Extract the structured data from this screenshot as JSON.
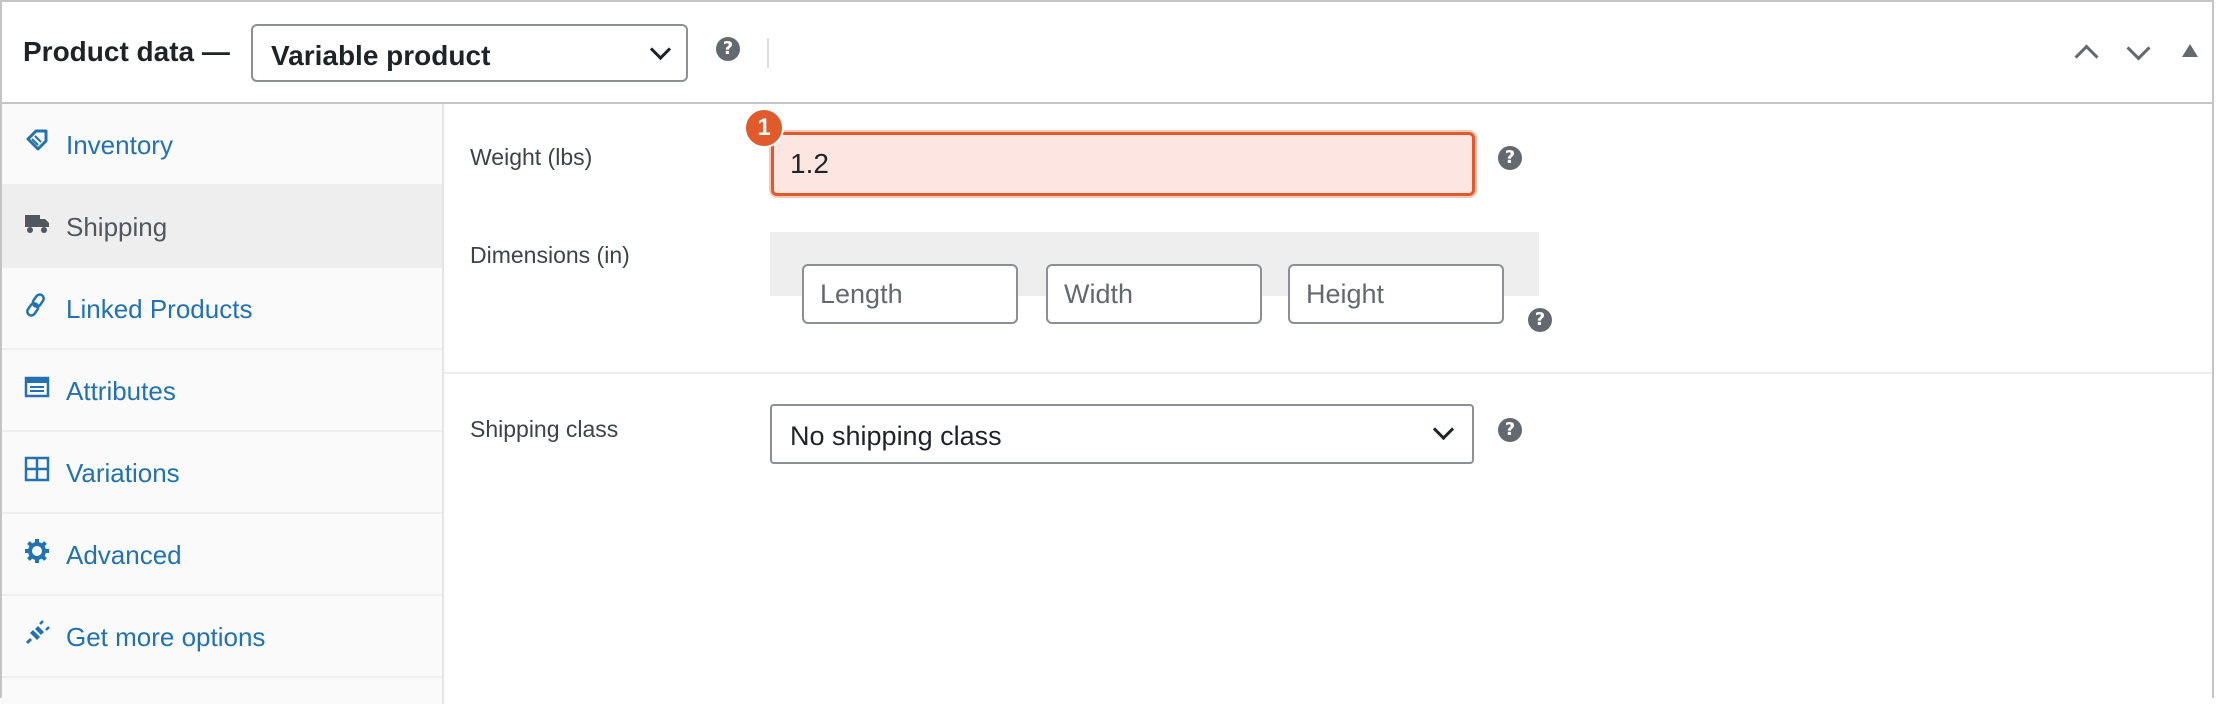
{
  "header": {
    "title": "Product data —",
    "product_type": "Variable product",
    "help_icon": "question-circle-icon",
    "controls": [
      "move-up-icon",
      "move-down-icon",
      "collapse-toggle-icon"
    ]
  },
  "sidebar": {
    "items": [
      {
        "label": "Inventory",
        "icon": "tag-icon",
        "active": false
      },
      {
        "label": "Shipping",
        "icon": "truck-icon",
        "active": true
      },
      {
        "label": "Linked Products",
        "icon": "link-icon",
        "active": false
      },
      {
        "label": "Attributes",
        "icon": "list-card-icon",
        "active": false
      },
      {
        "label": "Variations",
        "icon": "grid-icon",
        "active": false
      },
      {
        "label": "Advanced",
        "icon": "gear-icon",
        "active": false
      },
      {
        "label": "Get more options",
        "icon": "plug-icon",
        "active": false
      }
    ]
  },
  "shipping": {
    "weight": {
      "label": "Weight (lbs)",
      "value": "1.2",
      "badge": "1"
    },
    "dimensions": {
      "label": "Dimensions (in)",
      "length_placeholder": "Length",
      "width_placeholder": "Width",
      "height_placeholder": "Height"
    },
    "shipping_class": {
      "label": "Shipping class",
      "selected": "No shipping class"
    }
  },
  "colors": {
    "link": "#2271b1",
    "highlight_border": "#e15a2b",
    "highlight_bg": "#fde6e1"
  }
}
